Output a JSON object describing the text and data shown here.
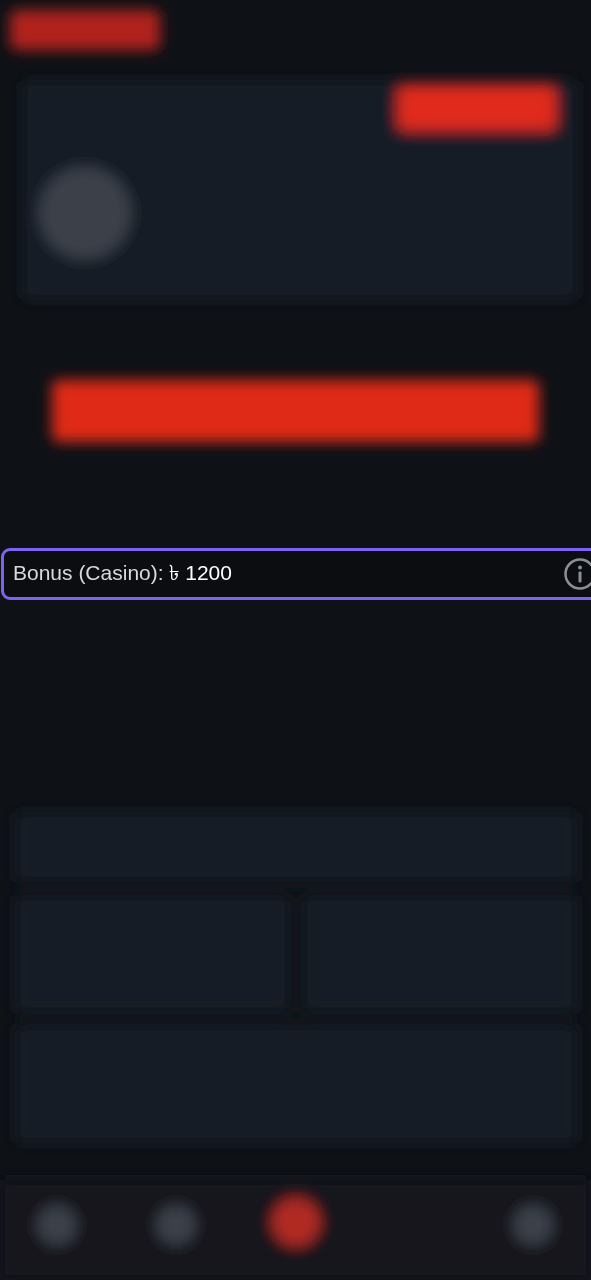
{
  "bonus_row": {
    "text": "Bonus (Casino): **৳ 1200**"
  }
}
